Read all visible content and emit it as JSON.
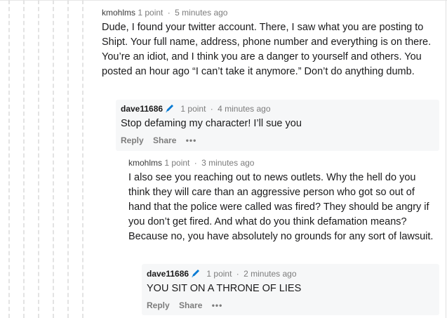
{
  "comments": [
    {
      "author": "kmohlms",
      "points": "1 point",
      "separator": "·",
      "time": "5 minutes ago",
      "body": "Dude, I found your twitter account. There, I saw what you are posting to Shipt. Your full name, address, phone number and everything is on there. You’re an idiot, and I think you are a danger to yourself and others. You posted an hour ago “I can’t take it anymore.” Don’t do anything dumb."
    },
    {
      "author": "dave11686",
      "points": "1 point",
      "separator": "·",
      "time": "4 minutes ago",
      "body": "Stop defaming my character! I’ll sue you",
      "actions": {
        "reply": "Reply",
        "share": "Share",
        "more": "•••"
      }
    },
    {
      "author": "kmohlms",
      "points": "1 point",
      "separator": "·",
      "time": "3 minutes ago",
      "body": "I also see you reaching out to news outlets. Why the hell do you think they will care than an aggressive person who got so out of hand that the police were called was fired? They should be angry if you don’t get fired. And what do you think defamation means? Because no, you have absolutely no grounds for any sort of lawsuit."
    },
    {
      "author": "dave11686",
      "points": "1 point",
      "separator": "·",
      "time": "2 minutes ago",
      "body": "YOU SIT ON A THRONE OF LIES",
      "actions": {
        "reply": "Reply",
        "share": "Share",
        "more": "•••"
      }
    }
  ],
  "colors": {
    "pencil": "#0079d3",
    "meta": "#7c7c7c",
    "shade": "#f6f7f8"
  },
  "icons": {
    "flair": "pencil-icon",
    "more": "more-options-icon"
  }
}
